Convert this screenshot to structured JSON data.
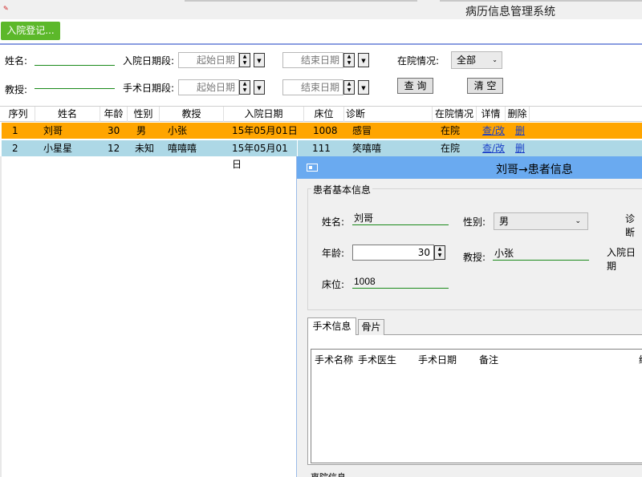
{
  "window": {
    "icon": "app-logo-icon",
    "title": "病历信息管理系统"
  },
  "toolbar": {
    "admit_label": "入院登记..."
  },
  "filters": {
    "name_label": "姓名:",
    "professor_label": "教授:",
    "admit_date_label": "入院日期段:",
    "surgery_date_label": "手术日期段:",
    "start_placeholder": "起始日期",
    "end_placeholder": "结束日期",
    "status_label": "在院情况:",
    "status_value": "全部",
    "query_label": "查 询",
    "clear_label": "清 空"
  },
  "grid": {
    "columns": [
      "序列",
      "姓名",
      "年龄",
      "性别",
      "教授",
      "入院日期",
      "床位",
      "诊断",
      "在院情况",
      "详情",
      "删除"
    ],
    "rows": [
      {
        "seq": "1",
        "name": "刘哥",
        "age": "30",
        "sex": "男",
        "professor": "小张",
        "admit_date": "15年05月01日",
        "bed": "1008",
        "diagnosis": "感冒",
        "status": "在院",
        "detail": "查/改",
        "delete": "删"
      },
      {
        "seq": "2",
        "name": "小星星",
        "age": "12",
        "sex": "未知",
        "professor": "嘻嘻嘻",
        "admit_date": "15年05月01日",
        "bed": "111",
        "diagnosis": "笑嘻嘻",
        "status": "在院",
        "detail": "查/改",
        "delete": "删"
      }
    ]
  },
  "dialog": {
    "title": "刘哥→患者信息",
    "group_label": "患者基本信息",
    "name_label": "姓名:",
    "name_value": "刘哥",
    "sex_label": "性别:",
    "sex_value": "男",
    "diag_label_partial": "诊断",
    "age_label": "年龄:",
    "age_value": "30",
    "professor_label": "教授:",
    "professor_value": "小张",
    "admit_label_partial": "入院日期",
    "bed_label": "床位:",
    "bed_value": "1008",
    "tabs": [
      "手术信息",
      "骨片"
    ],
    "surgery_columns": [
      "手术名称",
      "手术医生",
      "手术日期",
      "备注"
    ],
    "surgery_col_partial": "编",
    "bottom_partial": "离院信息"
  },
  "colors": {
    "accent_green": "#5cb82a",
    "row_selected": "#ffa500",
    "row_alt": "#add8e6",
    "dialog_title": "#6aaaf0"
  }
}
